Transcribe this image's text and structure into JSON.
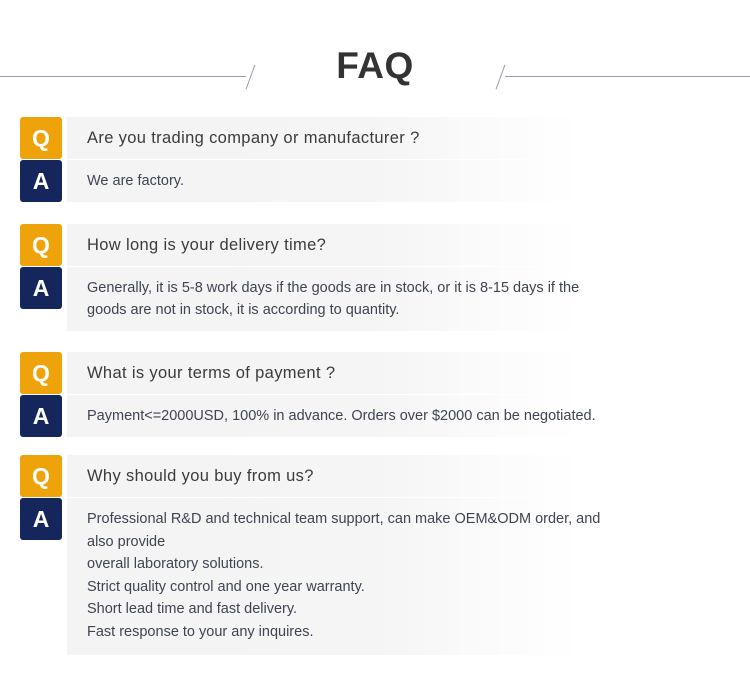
{
  "header": {
    "title": "FAQ",
    "rule_color": "#9a9fae"
  },
  "badges": {
    "question_letter": "Q",
    "answer_letter": "A",
    "question_color": "#efa30a",
    "answer_color": "#15265c"
  },
  "faq": {
    "items": [
      {
        "question": "Are you trading company or manufacturer ?",
        "answer_lines": [
          "We are factory."
        ]
      },
      {
        "question": "How long is your delivery time?",
        "answer_lines": [
          "Generally, it is 5-8 work days if the goods are in stock, or it is 8-15 days if the",
          "goods are not in stock, it is according to quantity."
        ]
      },
      {
        "question": "What is your terms of payment ?",
        "answer_lines": [
          "Payment<=2000USD, 100% in advance. Orders over $2000 can be negotiated."
        ]
      },
      {
        "question": "Why should you buy from us?",
        "answer_lines": [
          "Professional R&D and technical team support, can make OEM&ODM order, and also provide",
          "overall laboratory solutions.",
          "Strict quality control and one year warranty.",
          "Short lead time and fast delivery.",
          "Fast response to your any inquires."
        ]
      }
    ]
  }
}
